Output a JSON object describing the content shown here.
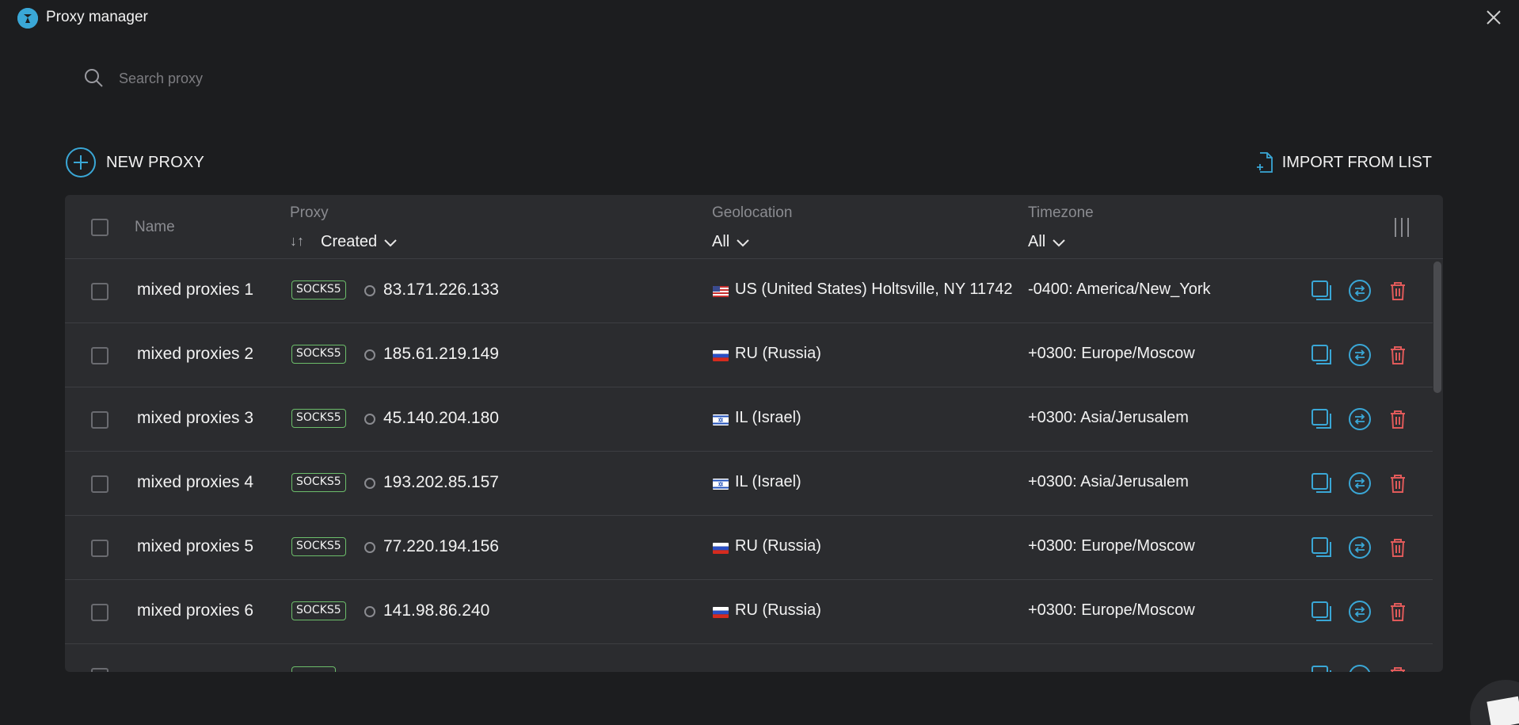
{
  "window": {
    "title": "Proxy manager"
  },
  "search": {
    "placeholder": "Search proxy"
  },
  "toolbar": {
    "new_proxy_label": "NEW PROXY",
    "import_label": "IMPORT FROM LIST"
  },
  "colors": {
    "accent": "#3aa7d6",
    "delete": "#e05a5a",
    "badge_border": "#6cbd6a",
    "background": "#1c1d1f",
    "panel": "#2b2c2f"
  },
  "table": {
    "headers": {
      "name": "Name",
      "proxy": "Proxy",
      "proxy_sort": "Created",
      "sort_arrows": "↓↑",
      "geolocation": "Geolocation",
      "geolocation_filter": "All",
      "timezone": "Timezone",
      "timezone_filter": "All"
    },
    "rows": [
      {
        "name": "mixed proxies 1",
        "type": "SOCKS5",
        "ip": "83.171.226.133",
        "flag": "us-flag-icon",
        "geo": "US (United States) Holtsville, NY 11742",
        "tz": "-0400: America/New_York"
      },
      {
        "name": "mixed proxies 2",
        "type": "SOCKS5",
        "ip": "185.61.219.149",
        "flag": "ru-flag-icon",
        "geo": "RU (Russia)",
        "tz": "+0300: Europe/Moscow"
      },
      {
        "name": "mixed proxies 3",
        "type": "SOCKS5",
        "ip": "45.140.204.180",
        "flag": "il-flag-icon",
        "geo": "IL (Israel)",
        "tz": "+0300: Asia/Jerusalem"
      },
      {
        "name": "mixed proxies 4",
        "type": "SOCKS5",
        "ip": "193.202.85.157",
        "flag": "il-flag-icon",
        "geo": "IL (Israel)",
        "tz": "+0300: Asia/Jerusalem"
      },
      {
        "name": "mixed proxies 5",
        "type": "SOCKS5",
        "ip": "77.220.194.156",
        "flag": "ru-flag-icon",
        "geo": "RU (Russia)",
        "tz": "+0300: Europe/Moscow"
      },
      {
        "name": "mixed proxies 6",
        "type": "SOCKS5",
        "ip": "141.98.86.240",
        "flag": "ru-flag-icon",
        "geo": "RU (Russia)",
        "tz": "+0300: Europe/Moscow"
      }
    ]
  }
}
